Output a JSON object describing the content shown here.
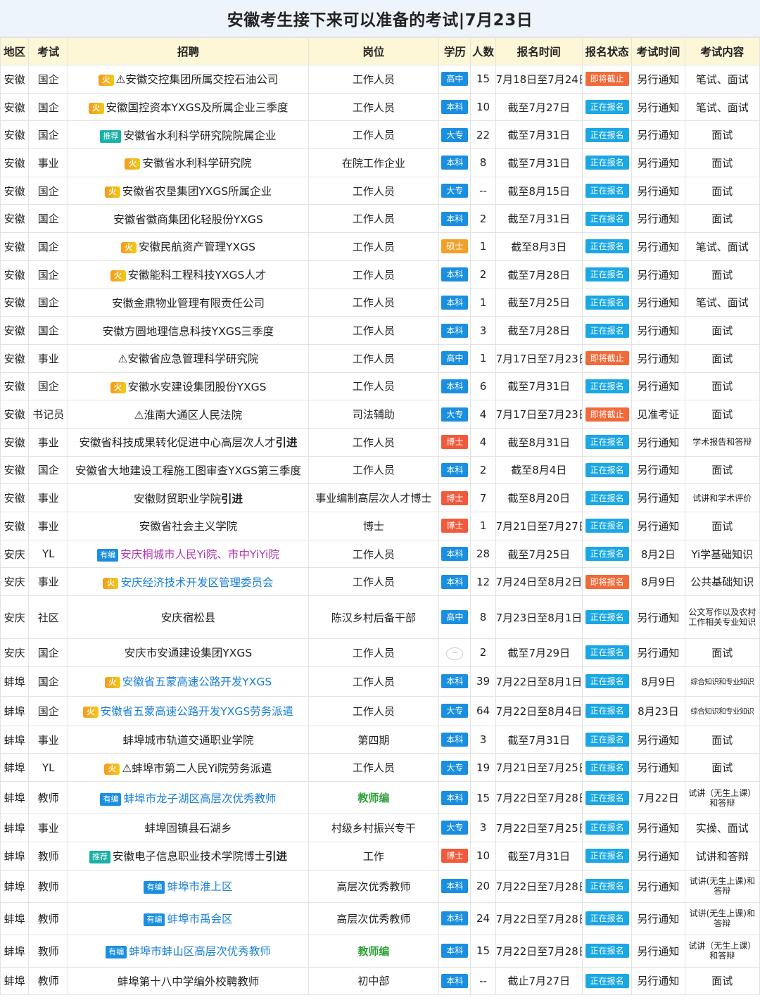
{
  "title": "安徽考生接下来可以准备的考试|7月23日",
  "headers": [
    "地区",
    "考试",
    "招聘",
    "岗位",
    "学历",
    "人数",
    "报名时间",
    "报名状态",
    "考试时间",
    "考试内容"
  ],
  "tags": {
    "fire": "火",
    "recommend": "推荐",
    "youbian": "有编"
  },
  "rows": [
    {
      "region": "安徽",
      "type": "国企",
      "prefix": "⚠",
      "name": "安徽交控集团所属交控石油公司",
      "suffix": "",
      "post": "工作人员",
      "edu": "高中",
      "num": "15",
      "time": "7月18日至7月24日",
      "status": "即将截止",
      "exam": "另行通知",
      "content": "笔试、面试"
    },
    {
      "region": "安徽",
      "type": "国企",
      "prefix": "",
      "name": "安徽国控资本YXGS及所属企业三季度",
      "suffix": "",
      "post": "工作人员",
      "edu": "本科",
      "num": "10",
      "time": "截至7月27日",
      "status": "正在报名",
      "exam": "另行通知",
      "content": "笔试、面试"
    },
    {
      "region": "安徽",
      "type": "国企",
      "prefix": "",
      "name": "安徽省水利科学研究院院属企业",
      "suffix": "",
      "post": "工作人员",
      "edu": "大专",
      "num": "22",
      "time": "截至7月31日",
      "status": "正在报名",
      "exam": "另行通知",
      "content": "面试"
    },
    {
      "region": "安徽",
      "type": "事业",
      "prefix": "",
      "name": "安徽省水利科学研究院",
      "suffix": "",
      "post": "在院工作企业",
      "edu": "本科",
      "num": "8",
      "time": "截至7月31日",
      "status": "正在报名",
      "exam": "另行通知",
      "content": "面试"
    },
    {
      "region": "安徽",
      "type": "国企",
      "prefix": "",
      "name": "安徽省农垦集团YXGS所属企业",
      "suffix": "",
      "post": "工作人员",
      "edu": "大专",
      "num": "--",
      "time": "截至8月15日",
      "status": "正在报名",
      "exam": "另行通知",
      "content": "面试"
    },
    {
      "region": "安徽",
      "type": "国企",
      "prefix": "",
      "name": "安徽省徽商集团化轻股份YXGS",
      "suffix": "",
      "post": "工作人员",
      "edu": "本科",
      "num": "2",
      "time": "截至7月31日",
      "status": "正在报名",
      "exam": "另行通知",
      "content": "面试"
    },
    {
      "region": "安徽",
      "type": "国企",
      "prefix": "",
      "name": "安徽民航资产管理YXGS",
      "suffix": "",
      "post": "工作人员",
      "edu": "硕士",
      "num": "1",
      "time": "截至8月3日",
      "status": "正在报名",
      "exam": "另行通知",
      "content": "笔试、面试"
    },
    {
      "region": "安徽",
      "type": "国企",
      "prefix": "",
      "name": "安徽能科工程科技YXGS人才",
      "suffix": "",
      "post": "工作人员",
      "edu": "本科",
      "num": "2",
      "time": "截至7月28日",
      "status": "正在报名",
      "exam": "另行通知",
      "content": "面试"
    },
    {
      "region": "安徽",
      "type": "国企",
      "prefix": "",
      "name": "安徽金鼎物业管理有限责任公司",
      "suffix": "",
      "post": "工作人员",
      "edu": "本科",
      "num": "1",
      "time": "截至7月25日",
      "status": "正在报名",
      "exam": "另行通知",
      "content": "笔试、面试"
    },
    {
      "region": "安徽",
      "type": "国企",
      "prefix": "",
      "name": "安徽方圆地理信息科技YXGS三季度",
      "suffix": "",
      "post": "工作人员",
      "edu": "本科",
      "num": "3",
      "time": "截至7月28日",
      "status": "正在报名",
      "exam": "另行通知",
      "content": "面试"
    },
    {
      "region": "安徽",
      "type": "事业",
      "prefix": "⚠",
      "name": "安徽省应急管理科学研究院",
      "suffix": "",
      "post": "工作人员",
      "edu": "高中",
      "num": "1",
      "time": "7月17日至7月23日",
      "status": "即将截止",
      "exam": "另行通知",
      "content": "面试"
    },
    {
      "region": "安徽",
      "type": "国企",
      "prefix": "",
      "name": "安徽水安建设集团股份YXGS",
      "suffix": "",
      "post": "工作人员",
      "edu": "本科",
      "num": "6",
      "time": "截至7月31日",
      "status": "正在报名",
      "exam": "另行通知",
      "content": "面试"
    },
    {
      "region": "安徽",
      "type": "书记员",
      "prefix": "⚠",
      "name": "淮南大通区人民法院",
      "suffix": "",
      "post": "司法辅助",
      "edu": "大专",
      "num": "4",
      "time": "7月17日至7月23日",
      "status": "即将截止",
      "exam": "见准考证",
      "content": "面试"
    },
    {
      "region": "安徽",
      "type": "事业",
      "prefix": "",
      "name": "安徽省科技成果转化促进中心高层次人才",
      "suffix": "引进",
      "post": "工作人员",
      "edu": "博士",
      "num": "4",
      "time": "截至8月31日",
      "status": "正在报名",
      "exam": "另行通知",
      "content": "学术报告和答辩"
    },
    {
      "region": "安徽",
      "type": "国企",
      "prefix": "",
      "name": "安徽省大地建设工程施工图审查YXGS第三季度",
      "suffix": "",
      "post": "工作人员",
      "edu": "本科",
      "num": "2",
      "time": "截至8月4日",
      "status": "正在报名",
      "exam": "另行通知",
      "content": "面试"
    },
    {
      "region": "安徽",
      "type": "事业",
      "prefix": "",
      "name": "安徽财贸职业学院",
      "suffix": "引进",
      "post": "事业编制高层次人才博士",
      "edu": "博士",
      "num": "7",
      "time": "截至8月20日",
      "status": "正在报名",
      "exam": "另行通知",
      "content": "试讲和学术评价"
    },
    {
      "region": "安徽",
      "type": "事业",
      "prefix": "",
      "name": "安徽省社会主义学院",
      "suffix": "",
      "post": "博士",
      "edu": "博士",
      "num": "1",
      "time": "7月21日至7月27日",
      "status": "正在报名",
      "exam": "另行通知",
      "content": "面试"
    },
    {
      "region": "安庆",
      "type": "YL",
      "prefix": "",
      "name": "安庆桐城市人民Yi院、市中YiYi院",
      "suffix": "",
      "post": "工作人员",
      "edu": "本科",
      "num": "28",
      "time": "截至7月25日",
      "status": "正在报名",
      "exam": "8月2日",
      "content": "Yi学基础知识"
    },
    {
      "region": "安庆",
      "type": "事业",
      "prefix": "",
      "name": "安庆经济技术开发区管理委员会",
      "suffix": "",
      "post": "工作人员",
      "edu": "本科",
      "num": "12",
      "time": "7月24日至8月2日",
      "status": "即将报名",
      "exam": "8月9日",
      "content": "公共基础知识"
    },
    {
      "region": "安庆",
      "type": "社区",
      "prefix": "",
      "name": "安庆宿松县",
      "suffix": "",
      "post": "陈汉乡村后备干部",
      "edu": "高中",
      "num": "8",
      "time": "7月23日至8月1日",
      "status": "正在报名",
      "exam": "另行通知",
      "content": "公文写作以及农村工作相关专业知识"
    },
    {
      "region": "安庆",
      "type": "国企",
      "prefix": "",
      "name": "安庆市安通建设集团YXGS",
      "suffix": "",
      "post": "工作人员",
      "edu": "--",
      "num": "2",
      "time": "截至7月29日",
      "status": "正在报名",
      "exam": "另行通知",
      "content": "面试"
    },
    {
      "region": "蚌埠",
      "type": "国企",
      "prefix": "",
      "name": "安徽省五蒙高速公路开发YXGS",
      "suffix": "",
      "post": "工作人员",
      "edu": "本科",
      "num": "39",
      "time": "7月22日至8月1日",
      "status": "正在报名",
      "exam": "8月9日",
      "content": "综合知识和专业知识"
    },
    {
      "region": "蚌埠",
      "type": "国企",
      "prefix": "",
      "name": "安徽省五蒙高速公路开发YXGS劳务派遣",
      "suffix": "",
      "post": "工作人员",
      "edu": "大专",
      "num": "64",
      "time": "7月22日至8月4日",
      "status": "正在报名",
      "exam": "8月23日",
      "content": "综合知识和专业知识"
    },
    {
      "region": "蚌埠",
      "type": "事业",
      "prefix": "",
      "name": "蚌埠城市轨道交通职业学院",
      "suffix": "",
      "post": "第四期",
      "edu": "本科",
      "num": "3",
      "time": "截至7月31日",
      "status": "正在报名",
      "exam": "另行通知",
      "content": "面试"
    },
    {
      "region": "蚌埠",
      "type": "YL",
      "prefix": "⚠",
      "name": "蚌埠市第二人民Yi院劳务派遣",
      "suffix": "",
      "post": "工作人员",
      "edu": "大专",
      "num": "19",
      "time": "7月21日至7月25日",
      "status": "正在报名",
      "exam": "另行通知",
      "content": "面试"
    },
    {
      "region": "蚌埠",
      "type": "教师",
      "prefix": "",
      "name": "蚌埠市龙子湖区高层次优秀教师",
      "suffix": "",
      "post": "教师编",
      "edu": "本科",
      "num": "15",
      "time": "7月22日至7月28日",
      "status": "正在报名",
      "exam": "7月22日",
      "content": "试讲（无生上课）和答辩"
    },
    {
      "region": "蚌埠",
      "type": "事业",
      "prefix": "",
      "name": "蚌埠固镇县石湖乡",
      "suffix": "",
      "post": "村级乡村振兴专干",
      "edu": "大专",
      "num": "3",
      "time": "7月22日至7月25日",
      "status": "正在报名",
      "exam": "另行通知",
      "content": "实操、面试"
    },
    {
      "region": "蚌埠",
      "type": "教师",
      "prefix": "",
      "name": "安徽电子信息职业技术学院博士",
      "suffix": "引进",
      "post": "工作",
      "edu": "博士",
      "num": "10",
      "time": "截至7月31日",
      "status": "正在报名",
      "exam": "另行通知",
      "content": "试讲和答辩"
    },
    {
      "region": "蚌埠",
      "type": "教师",
      "prefix": "",
      "name": "蚌埠市淮上区",
      "suffix": "",
      "post": "高层次优秀教师",
      "edu": "本科",
      "num": "20",
      "time": "7月22日至7月28日",
      "status": "正在报名",
      "exam": "另行通知",
      "content": "试讲(无生上课)和答辩"
    },
    {
      "region": "蚌埠",
      "type": "教师",
      "prefix": "",
      "name": "蚌埠市禹会区",
      "suffix": "",
      "post": "高层次优秀教师",
      "edu": "本科",
      "num": "24",
      "time": "7月22日至7月28日",
      "status": "正在报名",
      "exam": "另行通知",
      "content": "试讲(无生上课)和答辩"
    },
    {
      "region": "蚌埠",
      "type": "教师",
      "prefix": "",
      "name": "蚌埠市蚌山区高层次优秀教师",
      "suffix": "",
      "post": "教师编",
      "edu": "本科",
      "num": "15",
      "time": "7月22日至7月28日",
      "status": "正在报名",
      "exam": "另行通知",
      "content": "试讲（无生上课）和答辩"
    },
    {
      "region": "蚌埠",
      "type": "教师",
      "prefix": "",
      "name": "蚌埠第十八中学编外校聘教师",
      "suffix": "",
      "post": "初中部",
      "edu": "本科",
      "num": "--",
      "time": "截止7月27日",
      "status": "正在报名",
      "exam": "另行通知",
      "content": "面试"
    }
  ],
  "colors": {
    "header_bg": "#fdf7d8",
    "title_bg": "#eef4fb",
    "open": "#1aa7e3",
    "closing": "#f06a3a",
    "edu_blue": "#1a8fe0",
    "edu_orange": "#f0a12a",
    "edu_red": "#f05a3c",
    "link": "#1a7fd6"
  }
}
